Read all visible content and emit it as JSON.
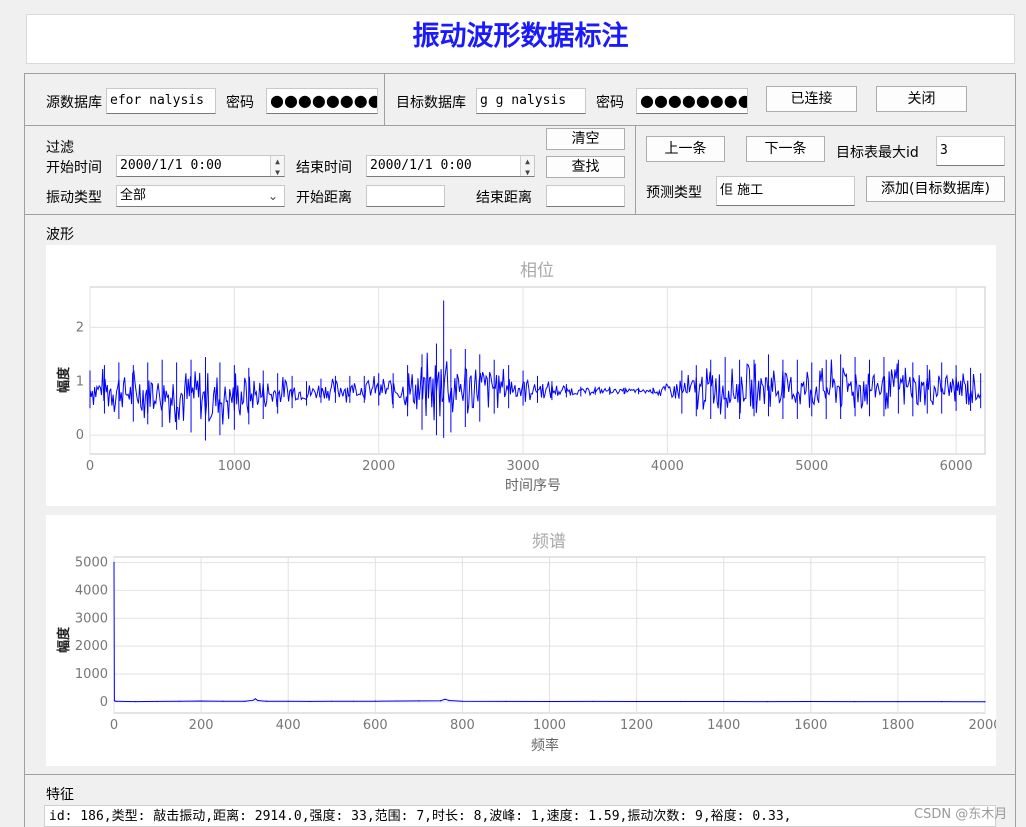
{
  "title": "振动波形数据标注",
  "connection": {
    "source_label": "源数据库",
    "source_value": "efor   nalysis",
    "password_label": "密码",
    "source_password": "●●●●●●●●●",
    "target_label": "目标数据库",
    "target_value": "g g   nalysis",
    "target_password": "●●●●●●●●●",
    "connected_button": "已连接",
    "close_button": "关闭"
  },
  "filter": {
    "group_label": "过滤",
    "start_time_label": "开始时间",
    "start_time_value": "2000/1/1 0:00",
    "end_time_label": "结束时间",
    "end_time_value": "2000/1/1 0:00",
    "vibration_type_label": "振动类型",
    "vibration_type_value": "全部",
    "start_distance_label": "开始距离",
    "start_distance_value": "",
    "end_distance_label": "结束距离",
    "end_distance_value": "",
    "clear_button": "清空",
    "search_button": "查找"
  },
  "navigation": {
    "prev_button": "上一条",
    "next_button": "下一条",
    "max_id_label": "目标表最大id",
    "max_id_value": "3",
    "predict_type_label": "预测类型",
    "predict_type_value": "佢       施工",
    "add_button": "添加(目标数据库)"
  },
  "waveform_section_label": "波形",
  "features_section_label": "特征",
  "features_text": "id: 186,类型: 敲击振动,距离: 2914.0,强度: 33,范围: 7,时长: 8,波峰: 1,速度: 1.59,振动次数: 9,裕度: 0.33,",
  "watermark": "CSDN @东木月",
  "colors": {
    "signal": "#0000ff",
    "title": "#1a1aff"
  },
  "chart_data": [
    {
      "type": "line",
      "title": "相位",
      "xlabel": "时间序号",
      "ylabel": "幅度",
      "xlim": [
        0,
        6200
      ],
      "ylim": [
        -0.35,
        2.75
      ],
      "xticks": [
        0,
        1000,
        2000,
        3000,
        4000,
        5000,
        6000
      ],
      "yticks": [
        0,
        1,
        2
      ],
      "series": [
        {
          "x": [
            0,
            100,
            200,
            300,
            400,
            500,
            600,
            700,
            800,
            900,
            1000,
            1100,
            1200,
            1300,
            1400,
            1500,
            1600,
            1700,
            1800,
            1900,
            2000,
            2100,
            2200,
            2300,
            2400,
            2450,
            2500,
            2600,
            2700,
            2800,
            2900,
            3000,
            3100,
            3200,
            3300,
            3400,
            3500,
            3600,
            3700,
            3800,
            3900,
            4100,
            4200,
            4300,
            4400,
            4500,
            4600,
            4700,
            4800,
            4900,
            5000,
            5100,
            5200,
            5300,
            5400,
            5500,
            5600,
            5700,
            5800,
            5900,
            6000,
            6100,
            6170
          ],
          "y_max": [
            1.2,
            1.3,
            1.35,
            1.3,
            1.35,
            1.4,
            1.35,
            1.4,
            1.45,
            1.35,
            1.3,
            1.25,
            1.2,
            1.15,
            1.1,
            1.0,
            1.05,
            1.1,
            1.1,
            1.1,
            1.15,
            1.15,
            1.3,
            1.5,
            1.7,
            2.5,
            1.6,
            1.6,
            1.5,
            1.4,
            1.3,
            1.2,
            1.1,
            1.0,
            0.95,
            0.9,
            0.9,
            0.9,
            0.88,
            0.88,
            0.88,
            1.2,
            1.3,
            1.4,
            1.45,
            1.4,
            1.4,
            1.5,
            1.4,
            1.4,
            1.35,
            1.4,
            1.5,
            1.45,
            1.4,
            1.45,
            1.4,
            1.35,
            1.3,
            1.35,
            1.3,
            1.25,
            1.15
          ],
          "y_min": [
            0.5,
            0.4,
            0.3,
            0.25,
            0.2,
            0.15,
            0.1,
            0.05,
            -0.1,
            0.0,
            0.1,
            0.2,
            0.3,
            0.4,
            0.5,
            0.55,
            0.6,
            0.6,
            0.6,
            0.6,
            0.55,
            0.5,
            0.35,
            0.1,
            0.0,
            -0.05,
            0.05,
            0.15,
            0.25,
            0.4,
            0.5,
            0.55,
            0.6,
            0.65,
            0.7,
            0.72,
            0.75,
            0.75,
            0.76,
            0.76,
            0.76,
            0.4,
            0.35,
            0.3,
            0.3,
            0.3,
            0.35,
            0.35,
            0.3,
            0.3,
            0.35,
            0.3,
            0.3,
            0.35,
            0.35,
            0.35,
            0.4,
            0.35,
            0.4,
            0.4,
            0.45,
            0.45,
            0.5
          ]
        }
      ]
    },
    {
      "type": "line",
      "title": "频谱",
      "xlabel": "频率",
      "ylabel": "幅度",
      "xlim": [
        0,
        2000
      ],
      "ylim": [
        -400,
        5200
      ],
      "xticks": [
        0,
        200,
        400,
        600,
        800,
        1000,
        1200,
        1400,
        1600,
        1800,
        2000
      ],
      "yticks": [
        0,
        1000,
        2000,
        3000,
        4000,
        5000
      ],
      "series": [
        {
          "x": [
            0,
            1,
            2,
            5,
            50,
            100,
            150,
            200,
            250,
            300,
            320,
            325,
            330,
            350,
            400,
            450,
            500,
            550,
            600,
            650,
            700,
            750,
            760,
            770,
            800,
            900,
            1000,
            1100,
            1200,
            1300,
            1400,
            1500,
            1600,
            1700,
            1800,
            1900,
            2000
          ],
          "y": [
            5000,
            60,
            30,
            20,
            10,
            15,
            20,
            30,
            25,
            20,
            60,
            110,
            50,
            25,
            20,
            15,
            20,
            20,
            25,
            30,
            35,
            40,
            90,
            50,
            20,
            15,
            12,
            15,
            12,
            14,
            12,
            10,
            12,
            10,
            8,
            8,
            5
          ]
        }
      ]
    }
  ]
}
